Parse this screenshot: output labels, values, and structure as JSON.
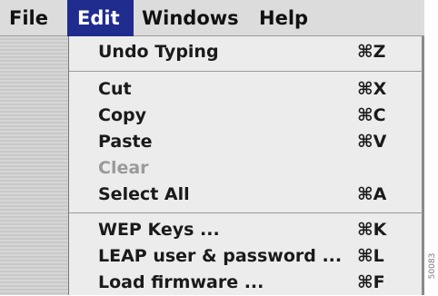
{
  "menubar": {
    "items": [
      {
        "label": "File"
      },
      {
        "label": "Edit"
      },
      {
        "label": "Windows"
      },
      {
        "label": "Help"
      }
    ],
    "active": "Edit"
  },
  "edit_menu": {
    "groups": [
      [
        {
          "label": "Undo Typing",
          "shortcut": "⌘Z",
          "enabled": true
        }
      ],
      [
        {
          "label": "Cut",
          "shortcut": "⌘X",
          "enabled": true
        },
        {
          "label": "Copy",
          "shortcut": "⌘C",
          "enabled": true
        },
        {
          "label": "Paste",
          "shortcut": "⌘V",
          "enabled": true
        },
        {
          "label": "Clear",
          "shortcut": "",
          "enabled": false
        },
        {
          "label": "Select All",
          "shortcut": "⌘A",
          "enabled": true
        }
      ],
      [
        {
          "label": "WEP Keys ...",
          "shortcut": "⌘K",
          "enabled": true
        },
        {
          "label": "LEAP user & password ...",
          "shortcut": "⌘L",
          "enabled": true
        },
        {
          "label": "Load firmware ...",
          "shortcut": "⌘F",
          "enabled": true
        }
      ]
    ]
  },
  "figure_id": "50083",
  "colors": {
    "menubar_bg": "#dcdcdc",
    "active_menu_bg": "#1f2c8e",
    "menu_bg": "#ececec",
    "disabled_text": "#9a9a9a"
  }
}
